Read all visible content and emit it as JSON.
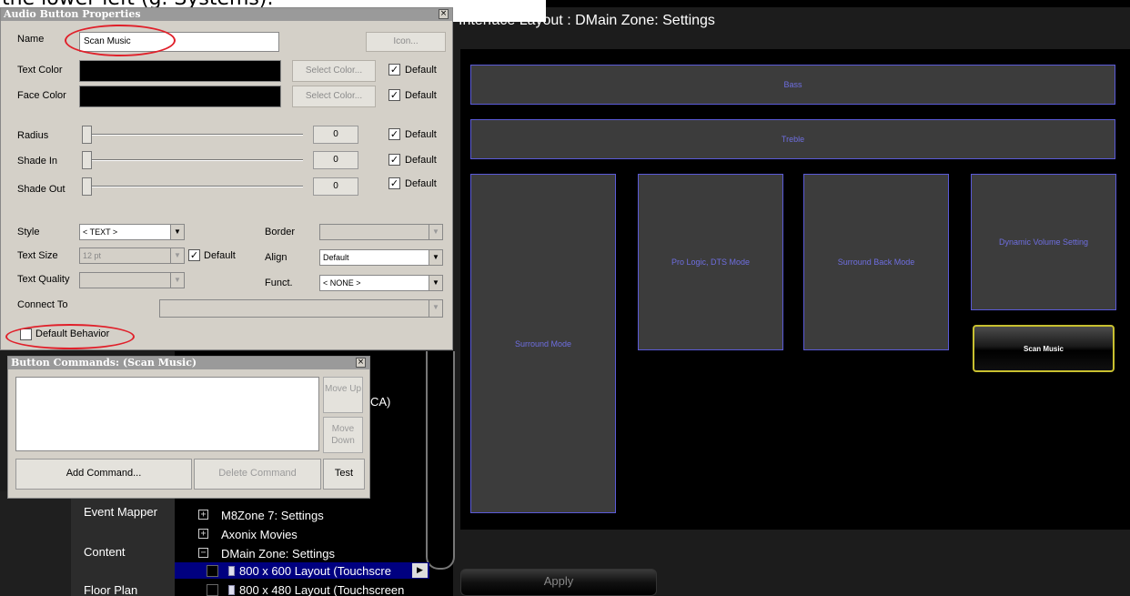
{
  "caption": "the lower left (g. Systems).",
  "layout_title": "Interface Layout : DMain Zone: Settings",
  "canvas_buttons": {
    "bass": "Bass",
    "treble": "Treble",
    "surround_mode": "Surround Mode",
    "pro_logic": "Pro Logic, DTS Mode",
    "surround_back": "Surround Back Mode",
    "dynamic_volume": "Dynamic Volume Setting",
    "scan_music": "Scan Music"
  },
  "apply_label": "Apply",
  "nav": {
    "event_mapper": "Event Mapper",
    "content": "Content",
    "floor_plan": "Floor Plan"
  },
  "tree": {
    "ca_fragment": "CA)",
    "items": [
      {
        "label": "M8Zone 7: Settings",
        "expander": "+"
      },
      {
        "label": "Axonix Movies",
        "expander": "+"
      },
      {
        "label": "DMain Zone: Settings",
        "expander": "−"
      }
    ],
    "layouts": [
      "800 x 600 Layout (Touchscre",
      "800 x 480 Layout (Touchscreen"
    ],
    "play_glyph": "▶"
  },
  "props_dialog": {
    "title": "Audio Button Properties",
    "close": "×",
    "name_label": "Name",
    "name_value": "Scan Music",
    "icon_button": "Icon...",
    "text_color_label": "Text Color",
    "face_color_label": "Face Color",
    "select_color": "Select Color...",
    "default_label": "Default",
    "check_glyph": "✓",
    "radius_label": "Radius",
    "shade_in_label": "Shade In",
    "shade_out_label": "Shade Out",
    "radius_value": "0",
    "shade_in_value": "0",
    "shade_out_value": "0",
    "style_label": "Style",
    "style_value": "< TEXT >",
    "text_size_label": "Text Size",
    "text_size_value": "12 pt",
    "text_quality_label": "Text Quality",
    "border_label": "Border",
    "align_label": "Align",
    "align_value": "Default",
    "funct_label": "Funct.",
    "funct_value": "< NONE >",
    "connect_label": "Connect To",
    "default_behavior": "Default Behavior",
    "arrow": "▼"
  },
  "commands_dialog": {
    "title": "Button Commands: (Scan Music)",
    "close": "×",
    "move_up": "Move Up",
    "move_down": "Move Down",
    "add_command": "Add Command...",
    "delete_command": "Delete Command",
    "test": "Test"
  },
  "colors": {
    "tile_border": "#5a5ad8",
    "tile_text": "#6e6ee0",
    "highlight_border": "#c8c030",
    "annotation": "#e0202a"
  }
}
